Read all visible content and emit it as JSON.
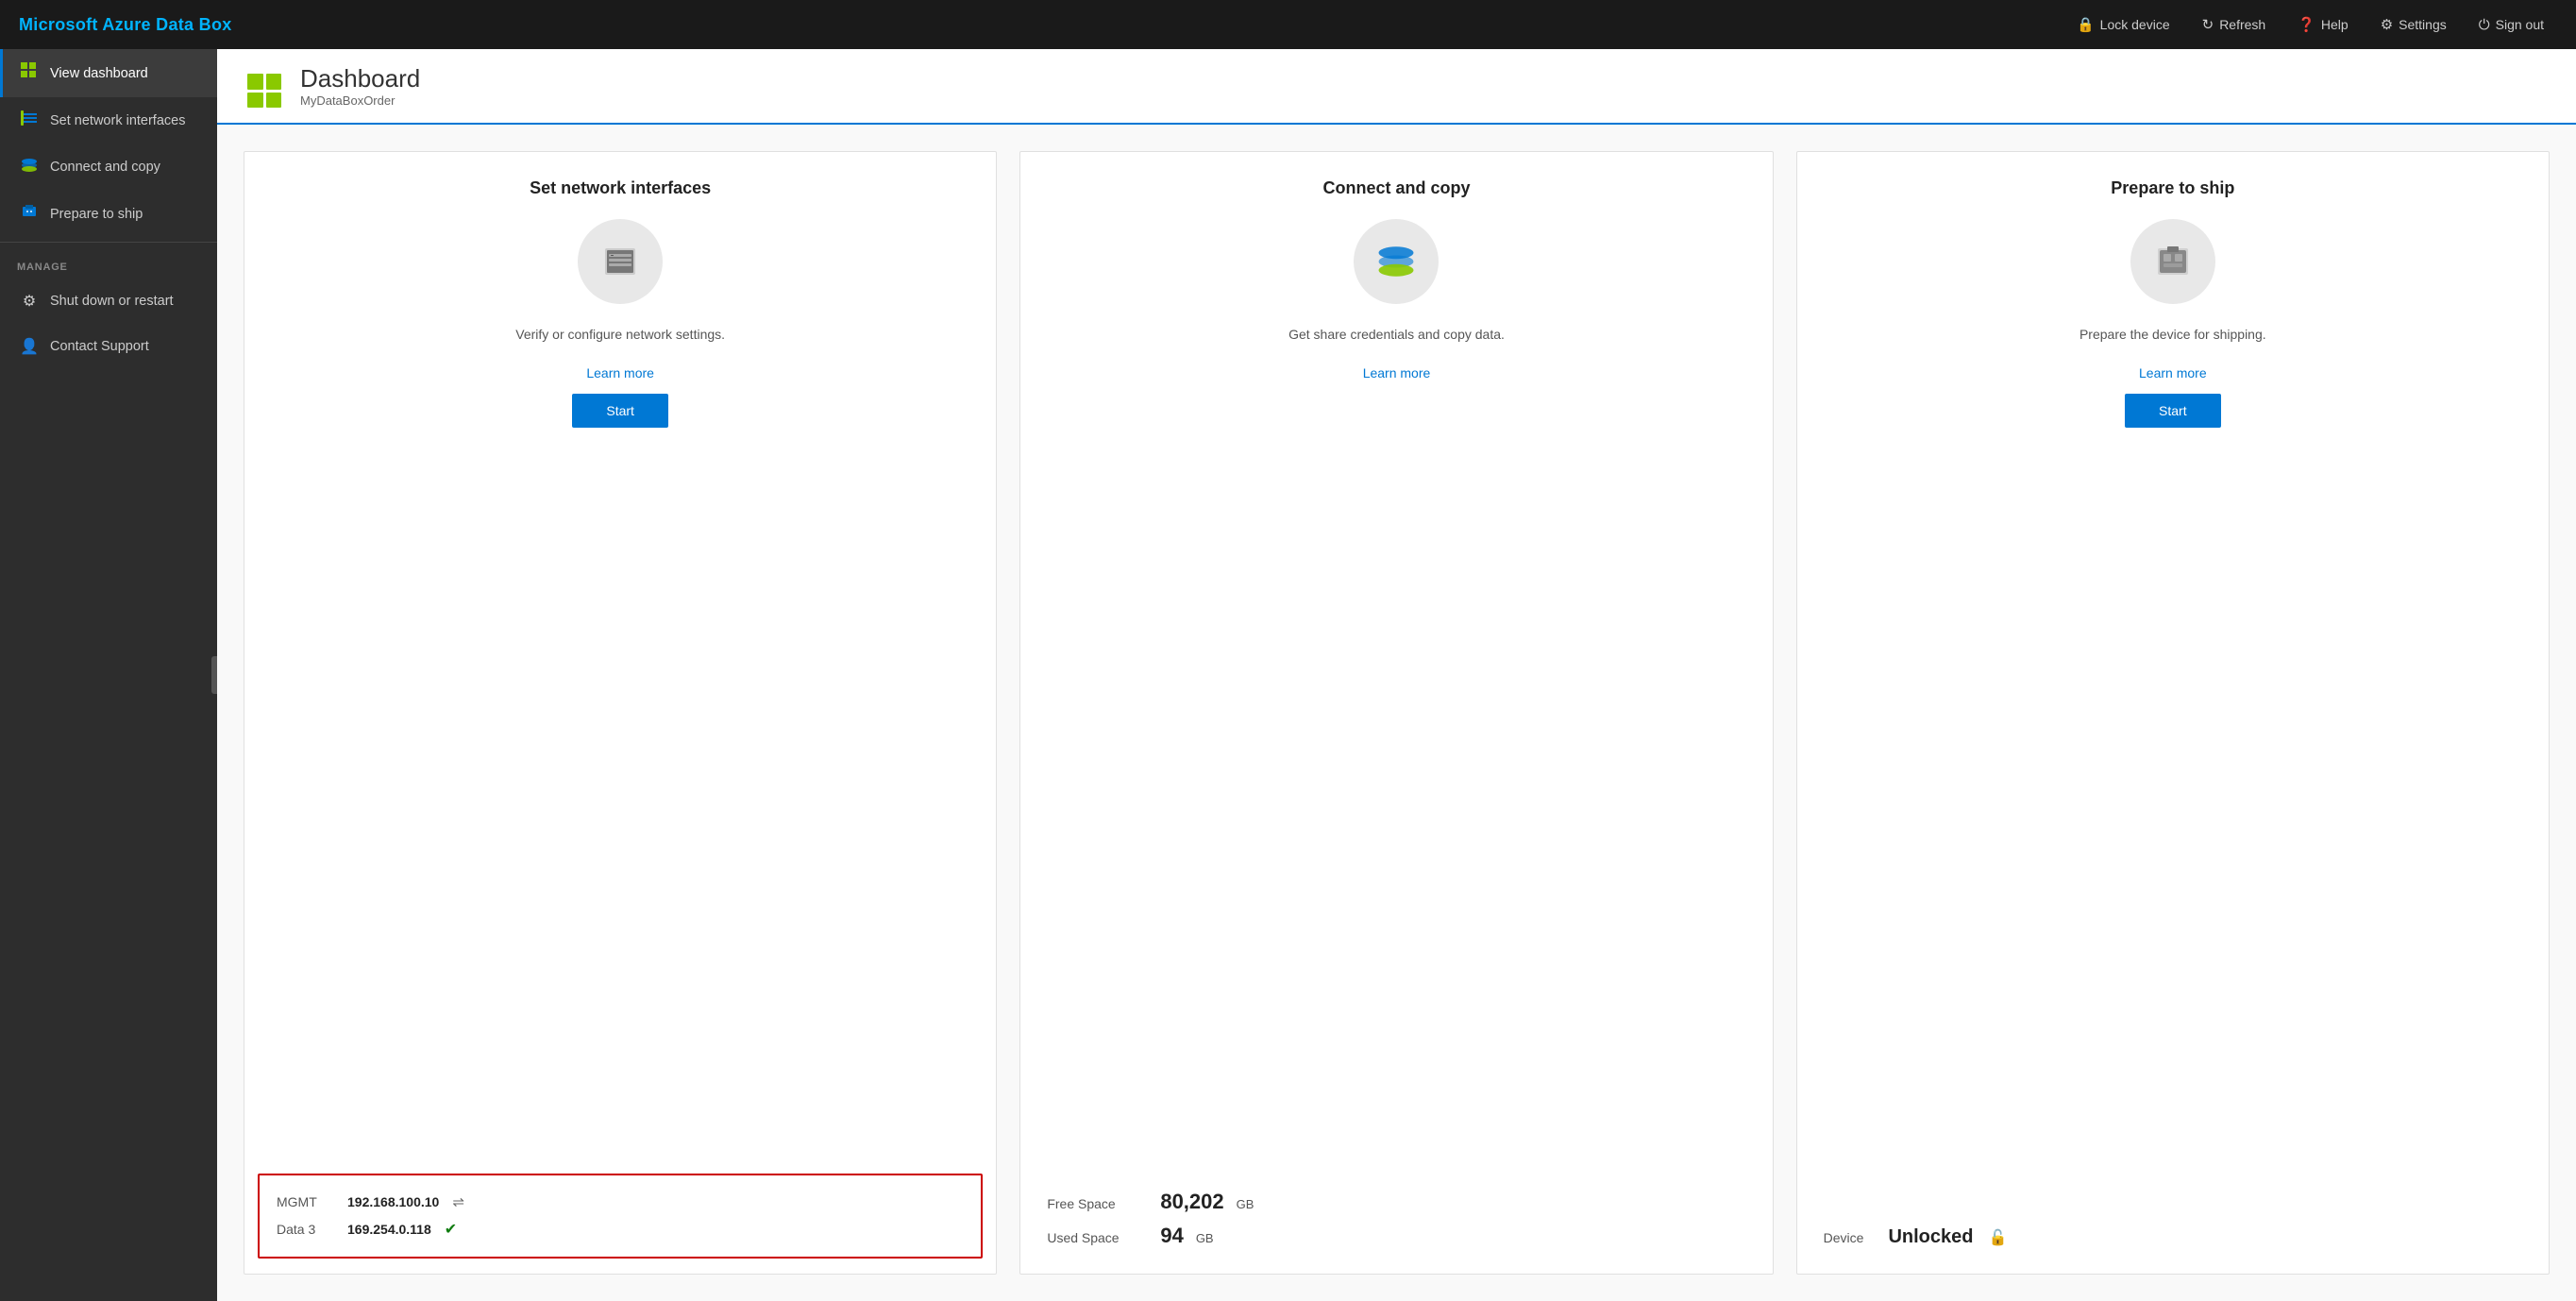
{
  "app": {
    "title": "Microsoft Azure Data Box"
  },
  "topbar": {
    "lock_label": "Lock device",
    "refresh_label": "Refresh",
    "help_label": "Help",
    "settings_label": "Settings",
    "signout_label": "Sign out"
  },
  "sidebar": {
    "items": [
      {
        "id": "view-dashboard",
        "label": "View dashboard",
        "icon": "grid",
        "active": true
      },
      {
        "id": "set-network",
        "label": "Set network interfaces",
        "icon": "network",
        "active": false
      },
      {
        "id": "connect-copy",
        "label": "Connect and copy",
        "icon": "copy",
        "active": false
      },
      {
        "id": "prepare-ship",
        "label": "Prepare to ship",
        "icon": "ship",
        "active": false
      }
    ],
    "manage_label": "MANAGE",
    "manage_items": [
      {
        "id": "shutdown",
        "label": "Shut down or restart",
        "icon": "gear"
      },
      {
        "id": "support",
        "label": "Contact Support",
        "icon": "person"
      }
    ]
  },
  "dashboard": {
    "title": "Dashboard",
    "subtitle": "MyDataBoxOrder"
  },
  "cards": {
    "network": {
      "title": "Set network interfaces",
      "description": "Verify or configure network settings.",
      "learn_more": "Learn more",
      "start_label": "Start",
      "interfaces": [
        {
          "name": "MGMT",
          "ip": "192.168.100.10",
          "status": "disconnected"
        },
        {
          "name": "Data 3",
          "ip": "169.254.0.118",
          "status": "connected"
        }
      ]
    },
    "copy": {
      "title": "Connect and copy",
      "description": "Get share credentials and copy data.",
      "learn_more": "Learn more",
      "free_space_label": "Free Space",
      "free_space_value": "80,202",
      "free_space_unit": "GB",
      "used_space_label": "Used Space",
      "used_space_value": "94",
      "used_space_unit": "GB"
    },
    "ship": {
      "title": "Prepare to ship",
      "description": "Prepare the device for shipping.",
      "learn_more": "Learn more",
      "start_label": "Start",
      "device_label": "Device",
      "device_status": "Unlocked"
    }
  }
}
